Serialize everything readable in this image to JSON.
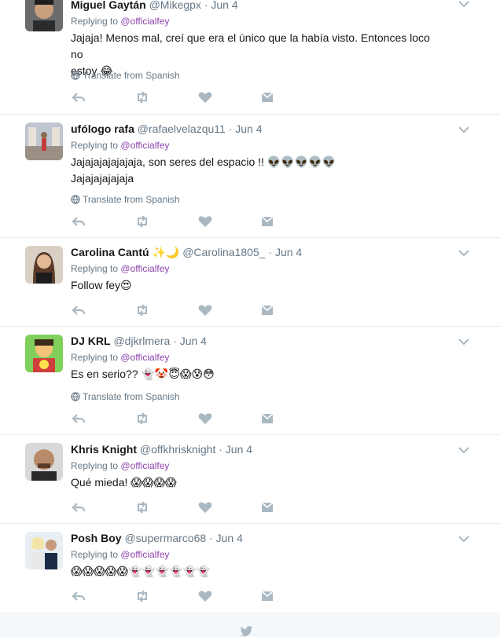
{
  "tweets": [
    {
      "name": "Miguel Gaytán",
      "handle": "@Mikegpx",
      "dot": "·",
      "time": "Jun 4",
      "reply_prefix": "Replying to",
      "reply_to": "@officialfey",
      "text_lines": [
        "Jajaja! Menos mal, creí que era el único que la había visto. Entonces loco no",
        "estoy 😂"
      ],
      "translate": "Translate from Spanish",
      "avatar_icon": "avatar-man-icon"
    },
    {
      "name": "ufólogo rafa",
      "handle": "@rafaelvelazqu11",
      "dot": "·",
      "time": "Jun 4",
      "reply_prefix": "Replying to",
      "reply_to": "@officialfey",
      "text_lines": [
        "Jajajajajajajaja, son seres del espacio !! 👽👽👽👽👽",
        "Jajajajajajaja"
      ],
      "translate": "Translate from Spanish",
      "avatar_icon": "avatar-street-icon"
    },
    {
      "name": "Carolina Cantú ✨🌙",
      "handle": "@Carolina1805_",
      "dot": "·",
      "time": "Jun 4",
      "reply_prefix": "Replying to",
      "reply_to": "@officialfey",
      "text_lines": [
        "Follow fey😍"
      ],
      "translate": "",
      "avatar_icon": "avatar-woman-icon"
    },
    {
      "name": "DJ KRL",
      "handle": "@djkrlmera",
      "dot": "·",
      "time": "Jun 4",
      "reply_prefix": "Replying to",
      "reply_to": "@officialfey",
      "text_lines": [
        "Es en serio?? 👻🤡😇😱😰😳"
      ],
      "translate": "Translate from Spanish",
      "avatar_icon": "avatar-cartoon-icon"
    },
    {
      "name": "Khris Knight",
      "handle": "@offkhrisknight",
      "dot": "·",
      "time": "Jun 4",
      "reply_prefix": "Replying to",
      "reply_to": "@officialfey",
      "text_lines": [
        "Qué mieda! 😱😱😱😱"
      ],
      "translate": "",
      "avatar_icon": "avatar-bald-man-icon"
    },
    {
      "name": "Posh Boy",
      "handle": "@supermarco68",
      "dot": "·",
      "time": "Jun 4",
      "reply_prefix": "Replying to",
      "reply_to": "@officialfey",
      "text_lines": [
        "😱😱😱😱😱👻👻👻👻👻👻"
      ],
      "translate": "",
      "avatar_icon": "avatar-couple-icon"
    }
  ],
  "colors": {
    "reply_link": "#8e44ad",
    "muted": "#657786",
    "action_icon": "#aab8c2",
    "divider": "#e6ecf0",
    "footer_bg": "#f5f8fa"
  },
  "icons": {
    "reply": "reply-icon",
    "retweet": "retweet-icon",
    "like": "heart-icon",
    "dm": "envelope-icon",
    "caret": "chevron-down-icon",
    "translate": "globe-icon",
    "footer": "twitter-bird-icon"
  }
}
